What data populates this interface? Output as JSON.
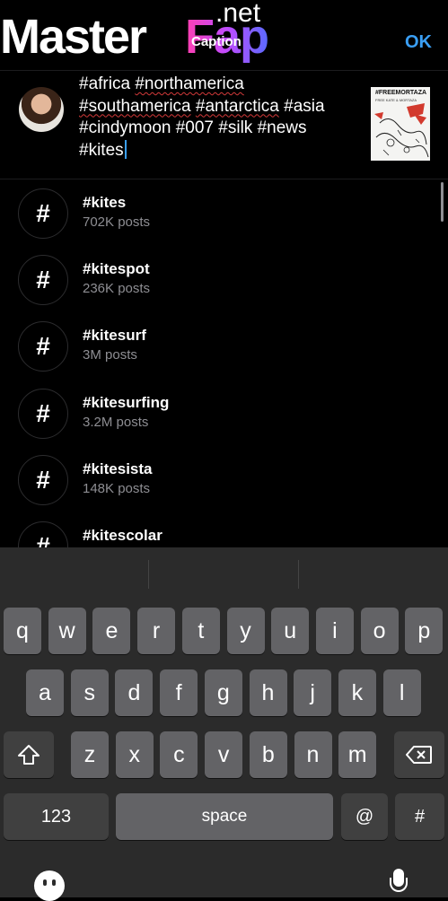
{
  "watermark": {
    "brand": "Master",
    "accent": "Fap",
    "suffix": ".net"
  },
  "header": {
    "title": "Caption",
    "ok_label": "OK"
  },
  "caption": {
    "lines": [
      [
        {
          "t": "#africa "
        },
        {
          "t": "#northamerica",
          "spell": true
        }
      ],
      [
        {
          "t": "#southamerica",
          "spell": true
        },
        {
          "t": " "
        },
        {
          "t": "#antarctica",
          "spell": true
        },
        {
          "t": " #asia"
        }
      ],
      [
        {
          "t": "#cindymoon #007 #silk #news"
        }
      ],
      [
        {
          "t": "#kites"
        }
      ]
    ],
    "thumbnail_title": "#FREEMORTAZA",
    "thumbnail_subtitle": "FREE KATE & MORTAZA"
  },
  "suggestions": [
    {
      "tag": "#kites",
      "posts": "702K posts",
      "icon": "hashtag-icon"
    },
    {
      "tag": "#kitespot",
      "posts": "236K posts",
      "icon": "hashtag-icon"
    },
    {
      "tag": "#kitesurf",
      "posts": "3M posts",
      "icon": "hashtag-icon"
    },
    {
      "tag": "#kitesurfing",
      "posts": "3.2M posts",
      "icon": "hashtag-icon"
    },
    {
      "tag": "#kitesista",
      "posts": "148K posts",
      "icon": "hashtag-icon"
    },
    {
      "tag": "#kitescolar",
      "posts": "",
      "icon": "hashtag-icon"
    }
  ],
  "keyboard": {
    "row1": [
      "q",
      "w",
      "e",
      "r",
      "t",
      "y",
      "u",
      "i",
      "o",
      "p"
    ],
    "row2": [
      "a",
      "s",
      "d",
      "f",
      "g",
      "h",
      "j",
      "k",
      "l"
    ],
    "row3": [
      "z",
      "x",
      "c",
      "v",
      "b",
      "n",
      "m"
    ],
    "numbers_label": "123",
    "space_label": "space",
    "at_label": "@",
    "hash_label": "#",
    "hash_glyph": "#",
    "shift_icon": "shift-icon",
    "delete_icon": "backspace-icon",
    "emoji_icon": "emoji-icon",
    "mic_icon": "microphone-icon"
  },
  "colors": {
    "accent": "#3a9ff5",
    "background": "#000000",
    "keyboard": "#2b2b2b",
    "key": "#636366",
    "muted": "#8e8e93"
  }
}
